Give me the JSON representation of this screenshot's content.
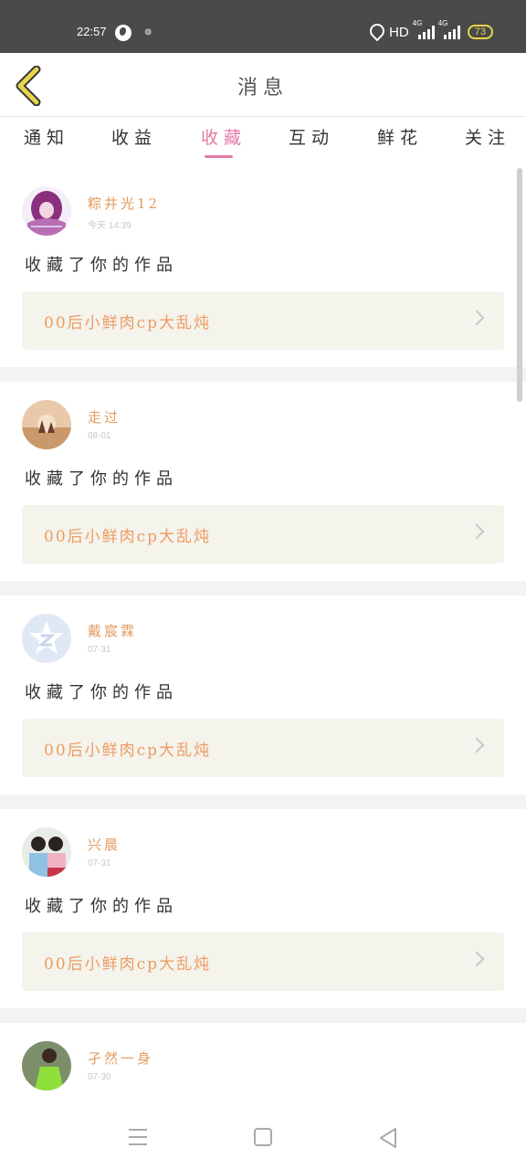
{
  "status_bar": {
    "time": "22:57",
    "small_icon": "⊚",
    "hd": "HD",
    "network_1": "4G",
    "network_2": "4G",
    "battery": "73"
  },
  "header": {
    "title": "消息",
    "back_icon": "chevron-left-icon"
  },
  "tabs": [
    {
      "label": "通知",
      "active": false
    },
    {
      "label": "收益",
      "active": false
    },
    {
      "label": "收藏",
      "active": true
    },
    {
      "label": "互动",
      "active": false
    },
    {
      "label": "鲜花",
      "active": false
    },
    {
      "label": "关注",
      "active": false
    }
  ],
  "items": [
    {
      "username": "粽井光12",
      "time": "今天 14:39",
      "action": "收藏了你的作品",
      "work_title": "00后小鲜肉cp大乱炖"
    },
    {
      "username": "走过",
      "time": "08-01",
      "action": "收藏了你的作品",
      "work_title": "00后小鲜肉cp大乱炖"
    },
    {
      "username": "戴宸霖",
      "time": "07-31",
      "action": "收藏了你的作品",
      "work_title": "00后小鲜肉cp大乱炖"
    },
    {
      "username": "兴晨",
      "time": "07-31",
      "action": "收藏了你的作品",
      "work_title": "00后小鲜肉cp大乱炖"
    },
    {
      "username": "孑然一身",
      "time": "07-30"
    }
  ],
  "colors": {
    "accent_pink": "#e57aa6",
    "username_orange": "#e39c60",
    "work_title_orange": "#ee9c62",
    "status_bar_bg": "#4a4a4a",
    "back_arrow_yellow": "#e8d44a"
  }
}
